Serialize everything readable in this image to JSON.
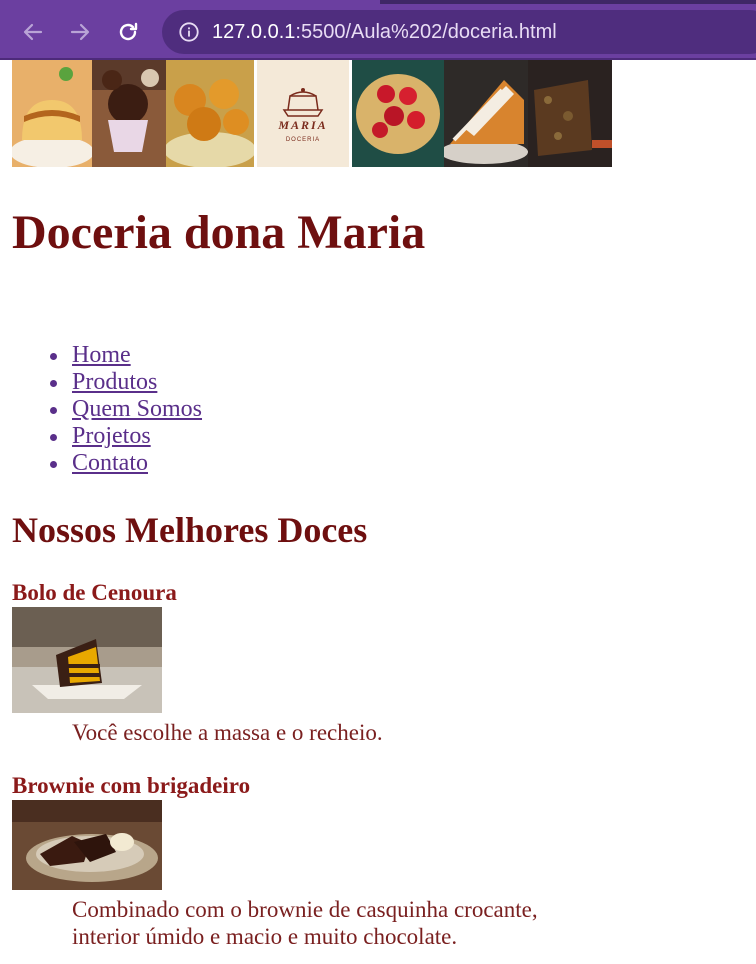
{
  "browser": {
    "url_host": "127.0.0.1",
    "url_rest": ":5500/Aula%202/doceria.html",
    "accent": "#6b3fa0"
  },
  "banner": {
    "logo_text": "MARIA",
    "logo_subtext": "DOCERIA"
  },
  "page": {
    "title": "Doceria dona Maria",
    "title_color": "#6e0f0f",
    "nav": [
      "Home",
      "Produtos",
      "Quem Somos",
      "Projetos",
      "Contato"
    ],
    "section_heading": "Nossos Melhores Doces",
    "products": [
      {
        "name": "Bolo de Cenoura",
        "description": "Você escolhe a massa e o recheio."
      },
      {
        "name": "Brownie com brigadeiro",
        "description": "Combinado com o brownie de casquinha crocante, interior úmido e macio e muito chocolate."
      }
    ]
  }
}
